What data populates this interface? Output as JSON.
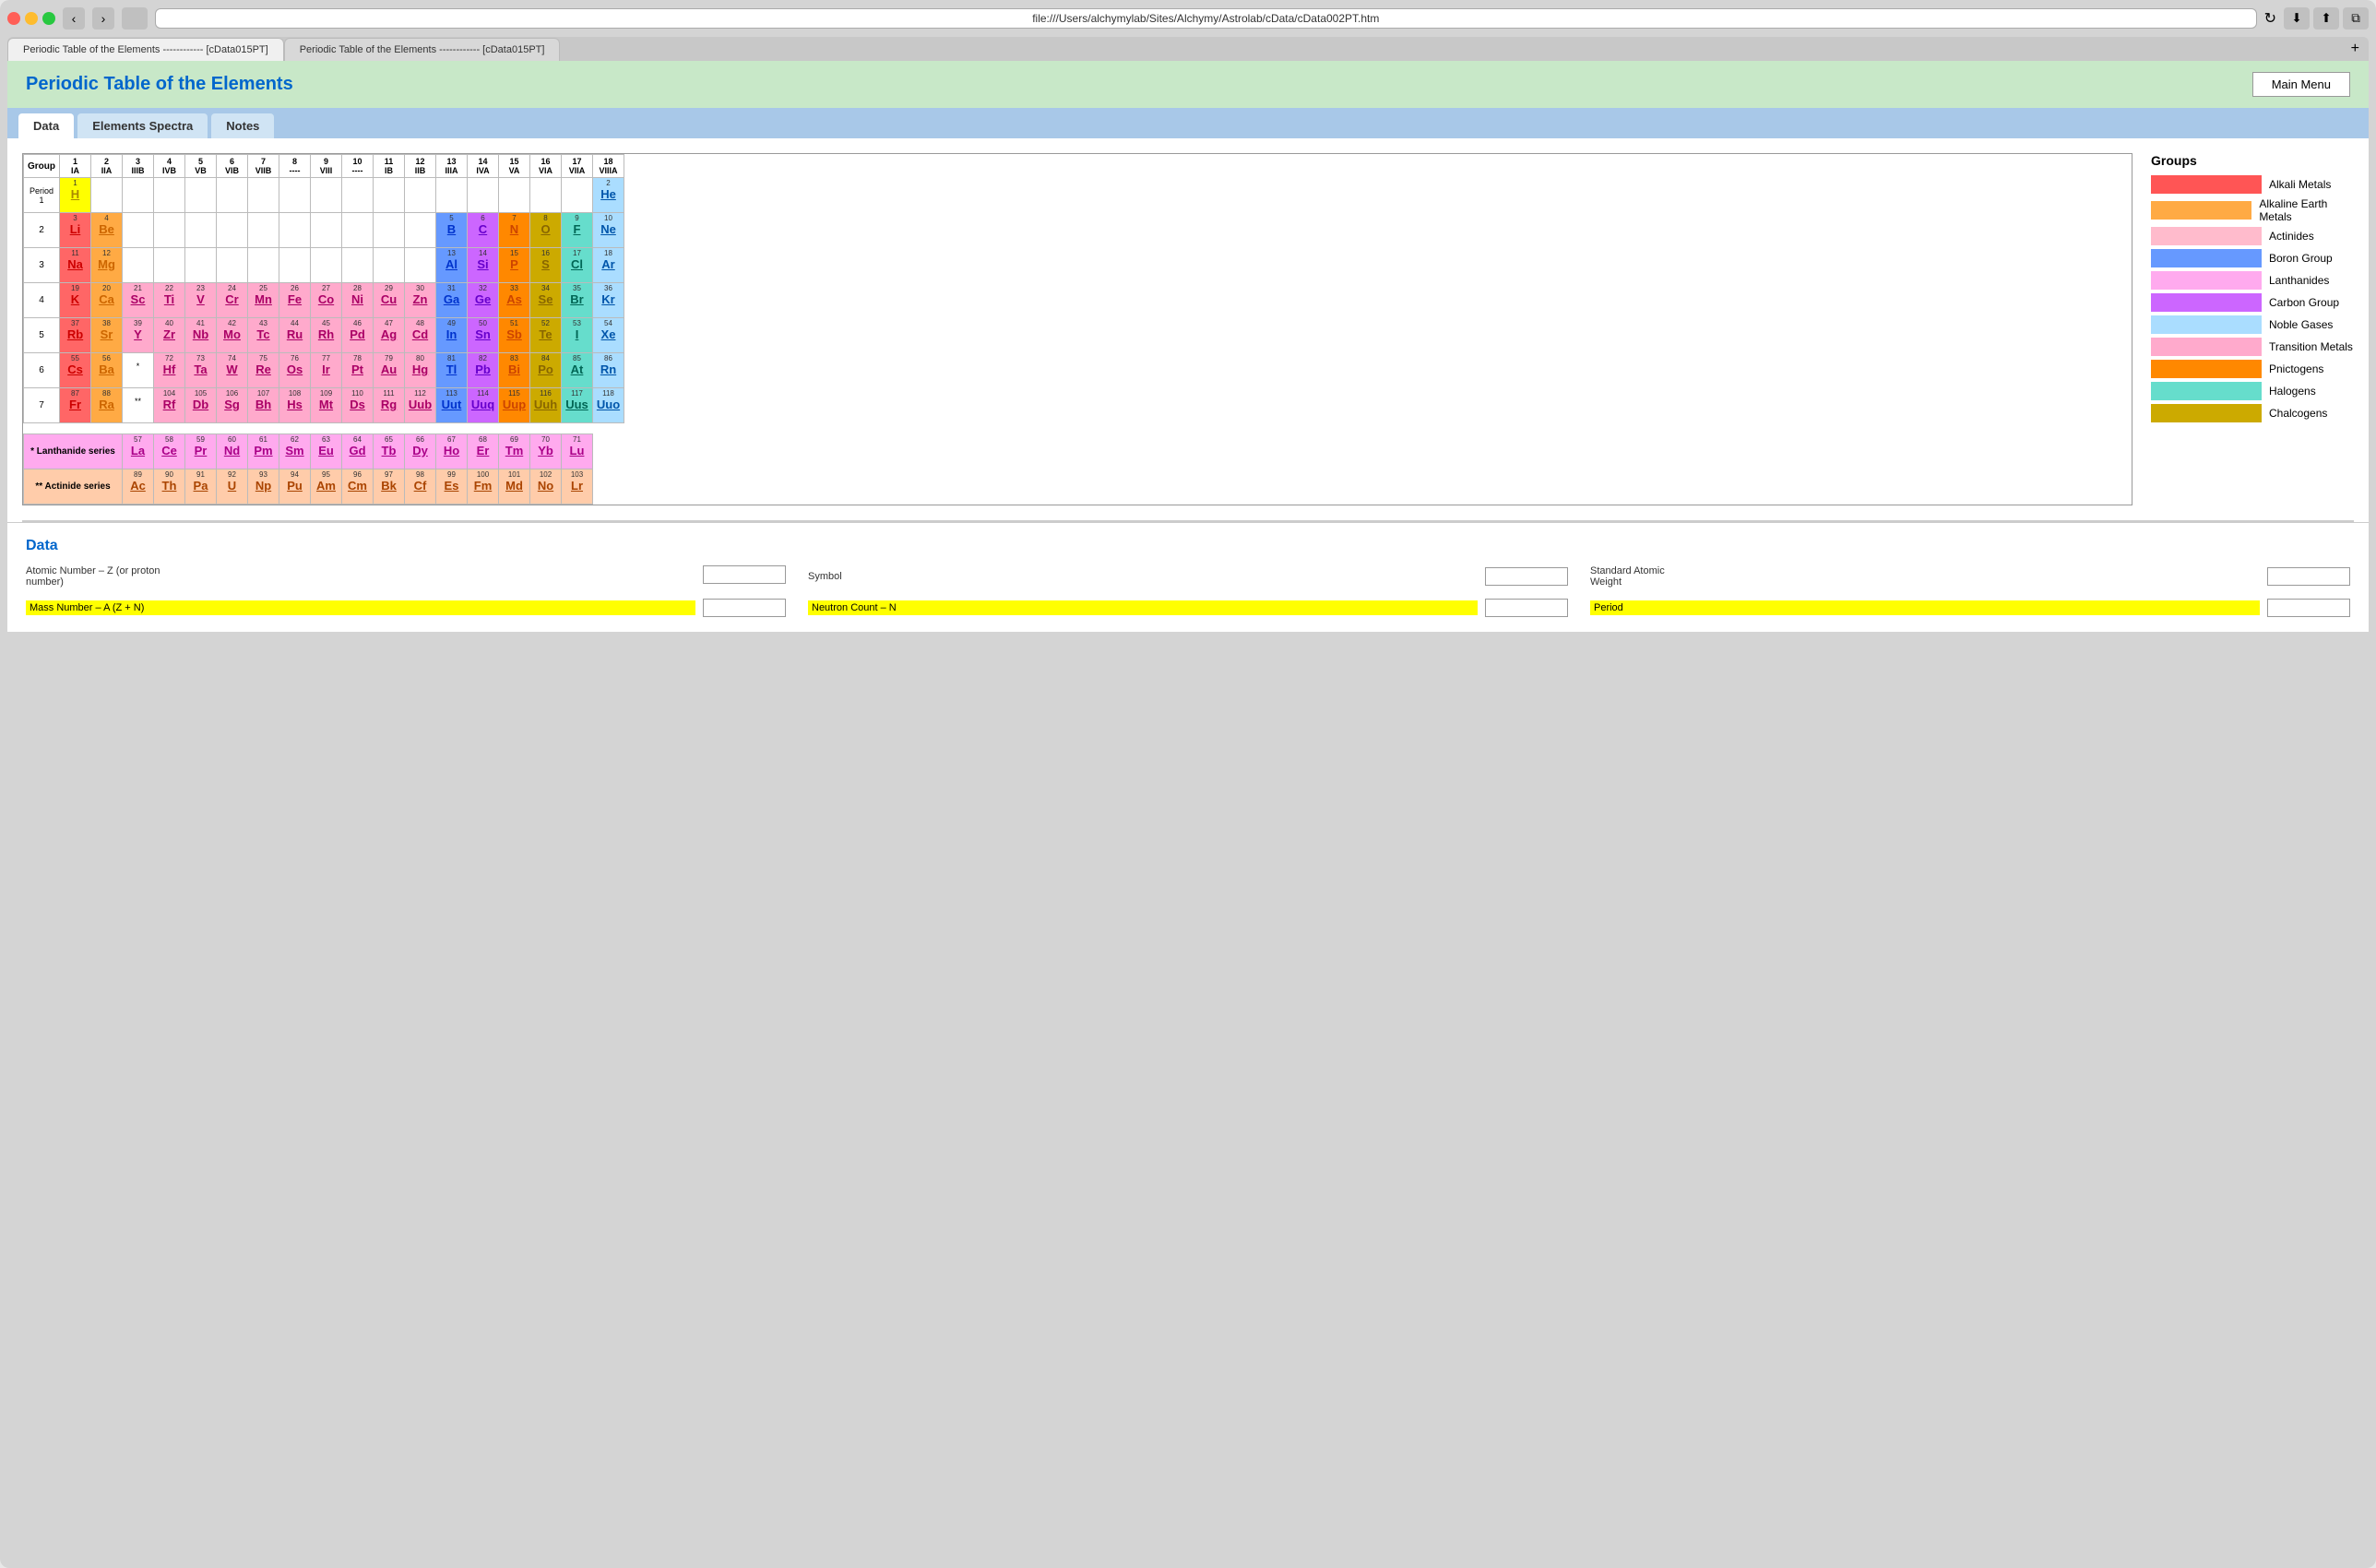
{
  "browser": {
    "address": "file:///Users/alchymylab/Sites/Alchymy/Astrolab/cData/cData002PT.htm",
    "tab1": "Periodic Table of the Elements ------------ [cData015PT]",
    "tab2": "Periodic Table of the Elements ------------ [cData015PT]"
  },
  "header": {
    "title": "Periodic Table of the Elements",
    "main_menu": "Main Menu"
  },
  "tabs": {
    "data": "Data",
    "elements_spectra": "Elements Spectra",
    "notes": "Notes"
  },
  "groups": {
    "title": "Groups",
    "items": [
      {
        "label": "Alkali Metals",
        "color": "#ff5555"
      },
      {
        "label": "Alkaline Earth Metals",
        "color": "#ffaa44"
      },
      {
        "label": "Actinides",
        "color": "#ffbbcc"
      },
      {
        "label": "Boron Group",
        "color": "#6699ff"
      },
      {
        "label": "Lanthanides",
        "color": "#ffaaee"
      },
      {
        "label": "Carbon Group",
        "color": "#cc66ff"
      },
      {
        "label": "Noble Gases",
        "color": "#aaddff"
      },
      {
        "label": "Transition Metals",
        "color": "#ffaacc"
      },
      {
        "label": "Pnictogens",
        "color": "#ff8800"
      },
      {
        "label": "Halogens",
        "color": "#66ddcc"
      },
      {
        "label": "Chalcogens",
        "color": "#ccaa00"
      }
    ]
  },
  "data_section": {
    "title": "Data",
    "fields": [
      {
        "label": "Atomic Number – Z (or proton number)",
        "highlight": false,
        "placeholder": ""
      },
      {
        "label": "Symbol",
        "highlight": false,
        "placeholder": ""
      },
      {
        "label": "Standard Atomic Weight",
        "highlight": false,
        "placeholder": ""
      },
      {
        "label": "Mass Number – A (Z + N)",
        "highlight": true,
        "placeholder": ""
      },
      {
        "label": "Neutron Count – N",
        "highlight": true,
        "placeholder": ""
      },
      {
        "label": "Period",
        "highlight": true,
        "placeholder": ""
      }
    ]
  }
}
